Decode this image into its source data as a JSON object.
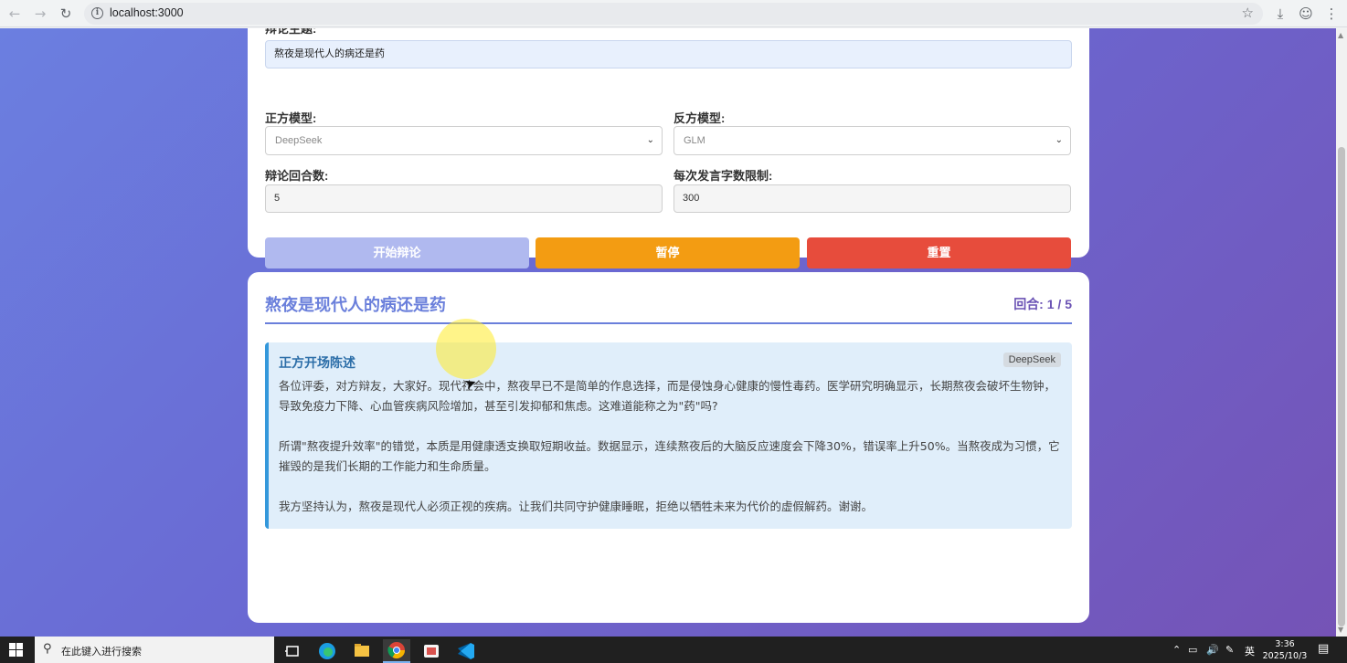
{
  "browser": {
    "url": "localhost:3000"
  },
  "settings": {
    "topic_label": "辩论主题:",
    "topic_value": "熬夜是现代人的病还是药",
    "pro_model_label": "正方模型:",
    "pro_model_value": "DeepSeek",
    "con_model_label": "反方模型:",
    "con_model_value": "GLM",
    "rounds_label": "辩论回合数:",
    "rounds_value": "5",
    "word_limit_label": "每次发言字数限制:",
    "word_limit_value": "300",
    "start_button": "开始辩论",
    "pause_button": "暂停",
    "reset_button": "重置"
  },
  "debate": {
    "title": "熬夜是现代人的病还是药",
    "round_label": "回合:",
    "round_value": "1 / 5",
    "speech": {
      "title": "正方开场陈述",
      "model": "DeepSeek",
      "paragraphs": [
        "各位评委，对方辩友，大家好。现代社会中，熬夜早已不是简单的作息选择，而是侵蚀身心健康的慢性毒药。医学研究明确显示，长期熬夜会破坏生物钟，导致免疫力下降、心血管疾病风险增加，甚至引发抑郁和焦虑。这难道能称之为\"药\"吗?",
        "所谓\"熬夜提升效率\"的错觉，本质是用健康透支换取短期收益。数据显示，连续熬夜后的大脑反应速度会下降30%，错误率上升50%。当熬夜成为习惯，它摧毁的是我们长期的工作能力和生命质量。",
        "我方坚持认为，熬夜是现代人必须正视的疾病。让我们共同守护健康睡眠，拒绝以牺牲未来为代价的虚假解药。谢谢。"
      ]
    }
  },
  "taskbar": {
    "search_placeholder": "在此键入进行搜索",
    "ime": "英",
    "time": "3:36",
    "date": "2025/10/3"
  },
  "colors": {
    "accent": "#6a7fdb",
    "pause": "#f39c12",
    "reset": "#e74c3c",
    "start_disabled": "#b0b9ef",
    "speech_border": "#3498db"
  },
  "icons": [
    "back-arrow-icon",
    "forward-arrow-icon",
    "reload-icon",
    "info-icon",
    "star-icon",
    "download-icon",
    "profile-icon",
    "menu-icon",
    "windows-icon",
    "search-icon",
    "task-view-icon",
    "edge-icon",
    "file-explorer-icon",
    "chrome-icon",
    "app-icon",
    "vscode-icon",
    "notification-icon"
  ]
}
